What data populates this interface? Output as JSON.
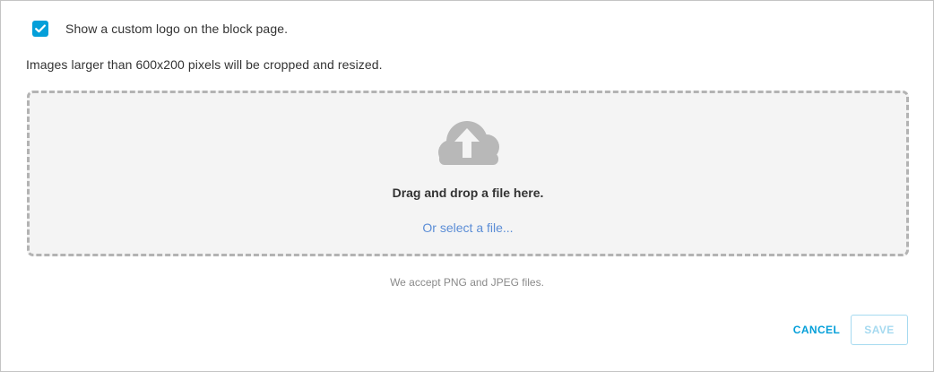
{
  "logo_option": {
    "checked": true,
    "label": "Show a custom logo on the block page."
  },
  "size_note": "Images larger than 600x200 pixels will be cropped and resized.",
  "dropzone": {
    "icon": "cloud-upload-icon",
    "title": "Drag and drop a file here.",
    "select_link": "Or select a file..."
  },
  "accept_note": "We accept PNG and JPEG files.",
  "actions": {
    "cancel_label": "CANCEL",
    "save_label": "SAVE"
  },
  "colors": {
    "accent": "#049fd9",
    "link": "#5b8dd6",
    "icon_gray": "#b8b8b8",
    "disabled_save": "#a6daf0"
  }
}
